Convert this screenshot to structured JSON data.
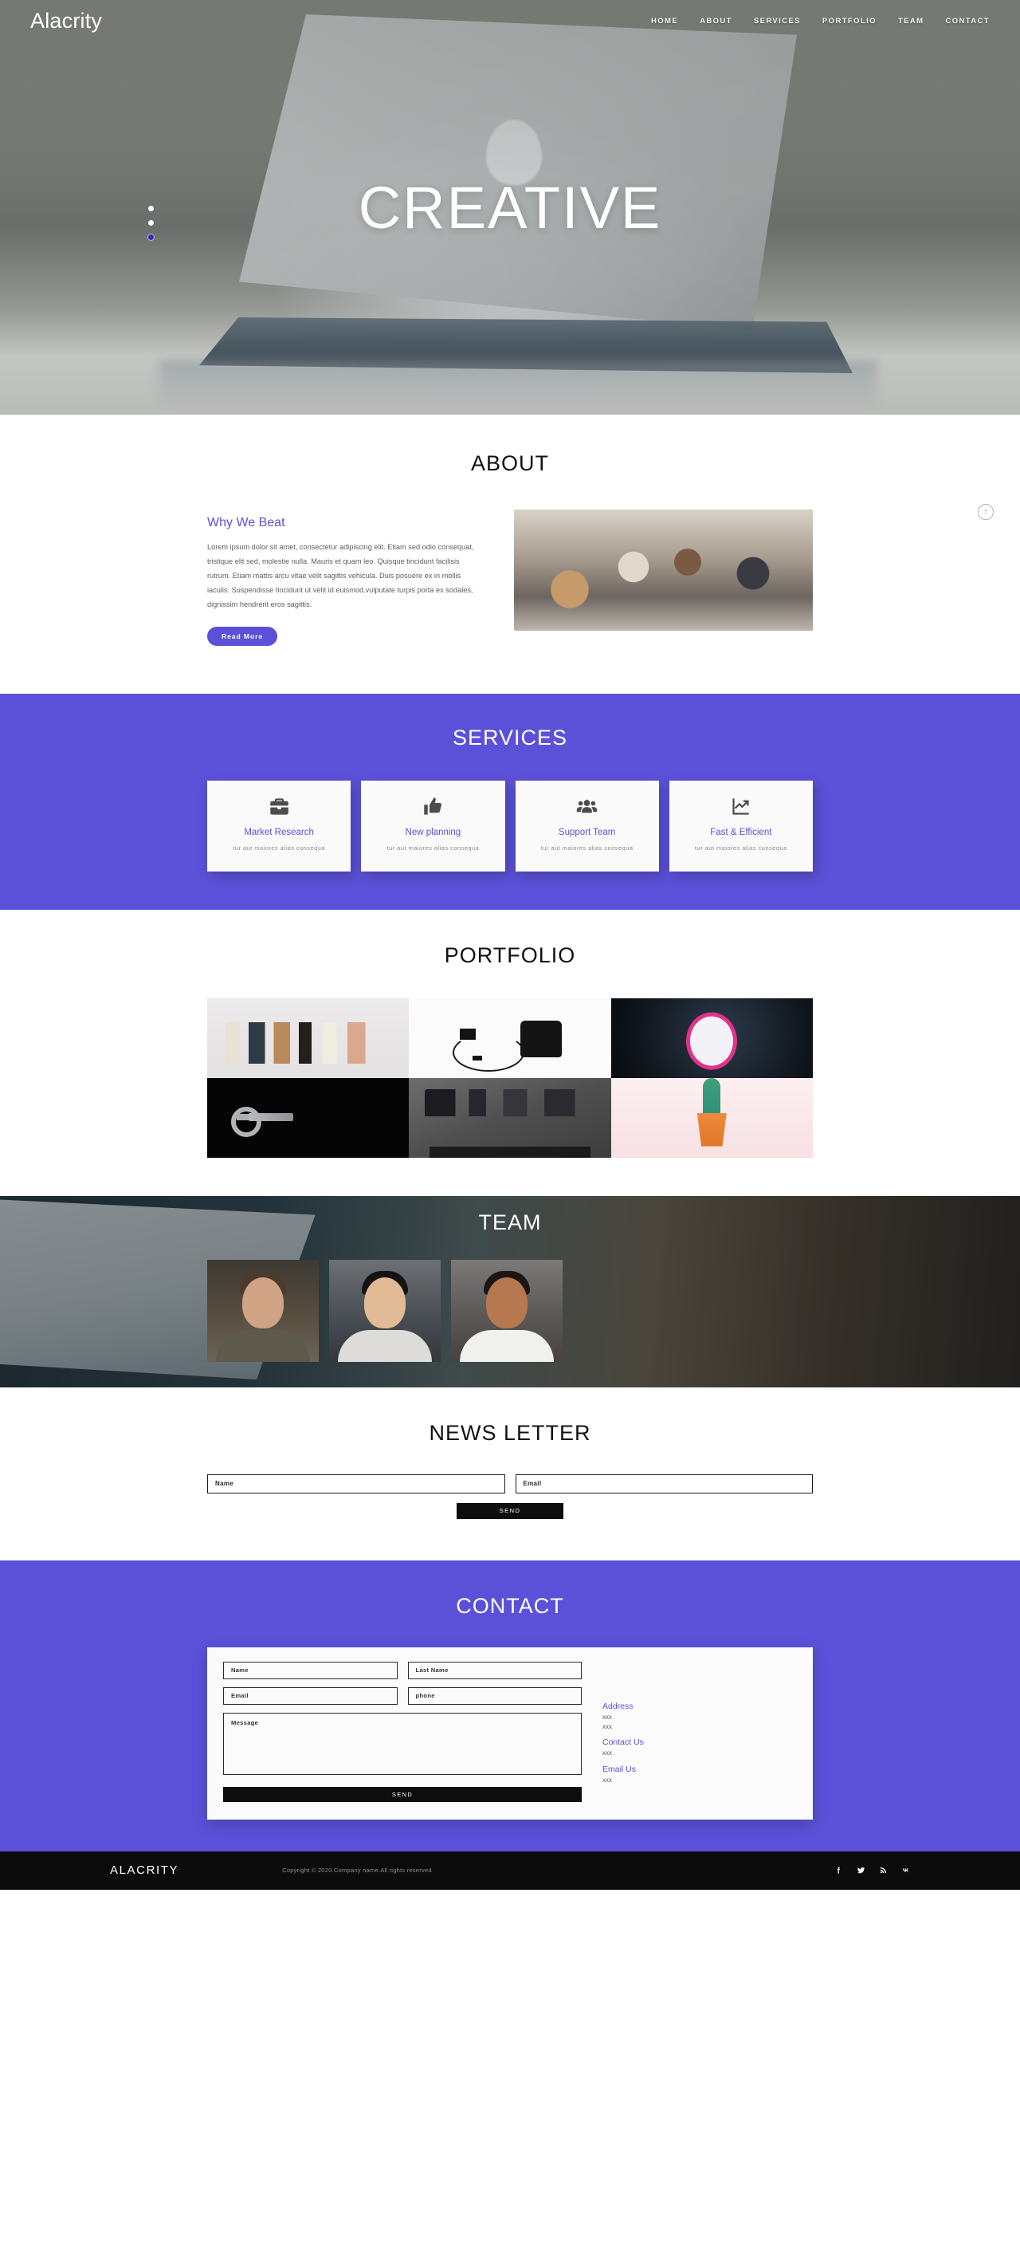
{
  "brand": "Alacrity",
  "nav": {
    "items": [
      {
        "label": "HOME"
      },
      {
        "label": "ABOUT"
      },
      {
        "label": "SERVICES"
      },
      {
        "label": "PORTFOLIO"
      },
      {
        "label": "TEAM"
      },
      {
        "label": "CONTACT"
      }
    ]
  },
  "hero": {
    "title": "CREATIVE",
    "slide_count": 3,
    "active_slide": 3
  },
  "about": {
    "section_title": "ABOUT",
    "heading": "Why We Beat",
    "paragraph": "Lorem ipsum dolor sit amet, consectetur adipiscing elit. Etiam sed odio consequat, tristique elit sed, molestie nulla. Mauris et quam leo. Quisque tincidunt facilisis rutrum. Etiam mattis arcu vitae velit sagittis vehicula. Duis posuere ex in mollis iaculis. Suspendisse tincidunt ut velit id euismod.vulputate turpis porta ex sodales, dignissim hendrerit eros sagittis.",
    "button_label": "Read More",
    "scroll_top_icon": "arrow-up-circle-icon"
  },
  "services": {
    "section_title": "SERVICES",
    "cards": [
      {
        "icon": "briefcase-icon",
        "title": "Market Research",
        "desc": "tur aut maiores alias consequa"
      },
      {
        "icon": "thumbs-up-icon",
        "title": "New planning",
        "desc": "tur aut maiores alias consequa"
      },
      {
        "icon": "users-group-icon",
        "title": "Support Team",
        "desc": "tur aut maiores alias consequa"
      },
      {
        "icon": "chart-growth-icon",
        "title": "Fast & Efficient",
        "desc": "tur aut maiores alias consequa"
      }
    ]
  },
  "portfolio": {
    "section_title": "PORTFOLIO",
    "items": [
      {
        "name": "price-tags-photo"
      },
      {
        "name": "rotary-telephone-photo"
      },
      {
        "name": "pink-alarm-clock-photo"
      },
      {
        "name": "silver-key-photo"
      },
      {
        "name": "flatlay-accessories-photo"
      },
      {
        "name": "cactus-in-pot-photo"
      }
    ]
  },
  "team": {
    "section_title": "TEAM",
    "members": [
      {
        "name": "team-member-1"
      },
      {
        "name": "team-member-2"
      },
      {
        "name": "team-member-3"
      }
    ]
  },
  "newsletter": {
    "section_title": "NEWS LETTER",
    "name_placeholder": "Name",
    "name_value": "",
    "email_placeholder": "Email",
    "email_value": "",
    "send_label": "SEND"
  },
  "contact": {
    "section_title": "CONTACT",
    "form": {
      "name_placeholder": "Name",
      "name_value": "",
      "last_name_placeholder": "Last Name",
      "last_name_value": "",
      "email_placeholder": "Email",
      "email_value": "",
      "phone_placeholder": "phone",
      "phone_value": "",
      "message_placeholder": "Message",
      "message_value": "",
      "send_label": "SEND"
    },
    "info": [
      {
        "heading": "Address",
        "lines": "xxx\nxxx"
      },
      {
        "heading": "Contact Us",
        "lines": "xxx"
      },
      {
        "heading": "Email Us",
        "lines": "xxx"
      }
    ]
  },
  "footer": {
    "brand": "ALACRITY",
    "copyright": "Copyright © 2020.Company name.All rights reserved",
    "social": [
      {
        "icon": "facebook-icon"
      },
      {
        "icon": "twitter-icon"
      },
      {
        "icon": "rss-icon"
      },
      {
        "icon": "vk-icon"
      }
    ]
  },
  "colors": {
    "accent": "#5b51d8",
    "dark": "#0b0b0b",
    "text": "#5e5e5e"
  }
}
